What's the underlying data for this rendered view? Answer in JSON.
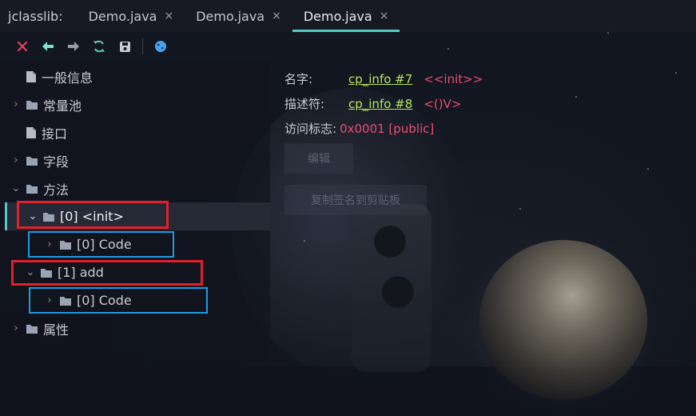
{
  "tabbar": {
    "app_title": "jclasslib:",
    "tabs": [
      {
        "label": "Demo.java",
        "close": "×"
      },
      {
        "label": "Demo.java",
        "close": "×"
      },
      {
        "label": "Demo.java",
        "close": "×",
        "active": true
      }
    ]
  },
  "toolbar": {
    "buttons": [
      "close-icon",
      "back-icon",
      "forward-icon",
      "refresh-icon",
      "save-icon",
      "web-icon"
    ],
    "colors": {
      "close": "#e8434f",
      "back": "#7fe0d6",
      "forward": "#9aa0ab",
      "refresh": "#5fd0a8",
      "save": "#c9ccd4",
      "web": "#4aa3ea"
    }
  },
  "tree": [
    {
      "label": "一般信息",
      "type": "file"
    },
    {
      "label": "常量池",
      "type": "folder",
      "expanded": false
    },
    {
      "label": "接口",
      "type": "file"
    },
    {
      "label": "字段",
      "type": "folder",
      "expanded": false
    },
    {
      "label": "方法",
      "type": "folder",
      "expanded": true
    },
    {
      "label": "[0] <init>",
      "type": "folder",
      "expanded": true,
      "selected": true
    },
    {
      "label": "[0] Code",
      "type": "folder",
      "expanded": false
    },
    {
      "label": "[1] add",
      "type": "folder",
      "expanded": true
    },
    {
      "label": "[0] Code",
      "type": "folder",
      "expanded": false
    },
    {
      "label": "属性",
      "type": "folder",
      "expanded": false
    }
  ],
  "details": {
    "name_label": "名字:",
    "name_link": "cp_info #7",
    "name_value": "<<init>>",
    "desc_label": "描述符:",
    "desc_link": "cp_info #8",
    "desc_value": "<()V>",
    "flags_label": "访问标志:",
    "flags_value": "0x0001 [public]",
    "edit_button": "编辑",
    "copy_button": "复制签名到剪贴板"
  },
  "annotations": {
    "red_color": "#e0202a",
    "blue_color": "#1e9be0"
  }
}
